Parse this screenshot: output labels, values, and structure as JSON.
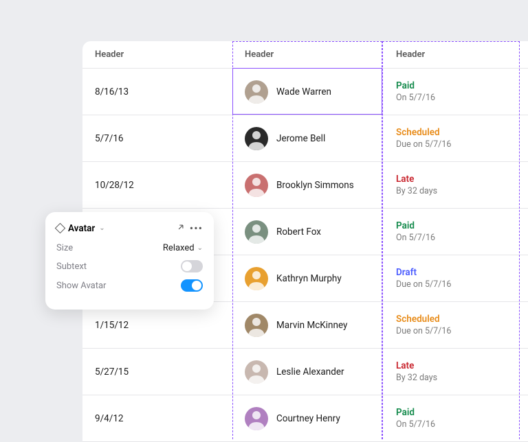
{
  "columns": [
    "Header",
    "Header",
    "Header"
  ],
  "rows": [
    {
      "date": "8/16/13",
      "name": "Wade Warren",
      "avatar_bg": "#b0a090",
      "status": "Paid",
      "sub": "On 5/7/16"
    },
    {
      "date": "5/7/16",
      "name": "Jerome Bell",
      "avatar_bg": "#2a2a2a",
      "status": "Scheduled",
      "sub": "Due on 5/7/16"
    },
    {
      "date": "10/28/12",
      "name": "Brooklyn Simmons",
      "avatar_bg": "#c97070",
      "status": "Late",
      "sub": "By 32 days"
    },
    {
      "date": "",
      "name": "Robert Fox",
      "avatar_bg": "#7a9080",
      "status": "Paid",
      "sub": "On 5/7/16"
    },
    {
      "date": "",
      "name": "Kathryn Murphy",
      "avatar_bg": "#e8a030",
      "status": "Draft",
      "sub": "Due on 5/7/16"
    },
    {
      "date": "1/15/12",
      "name": "Marvin McKinney",
      "avatar_bg": "#a08868",
      "status": "Scheduled",
      "sub": "Due on 5/7/16"
    },
    {
      "date": "5/27/15",
      "name": "Leslie Alexander",
      "avatar_bg": "#c8b8b0",
      "status": "Late",
      "sub": "By 32 days"
    },
    {
      "date": "9/4/12",
      "name": "Courtney Henry",
      "avatar_bg": "#b080c0",
      "status": "Paid",
      "sub": "On 5/7/16"
    }
  ],
  "panel": {
    "title": "Avatar",
    "rows": [
      {
        "label": "Size",
        "type": "select",
        "value": "Relaxed"
      },
      {
        "label": "Subtext",
        "type": "toggle",
        "value": false
      },
      {
        "label": "Show Avatar",
        "type": "toggle",
        "value": true
      }
    ]
  }
}
